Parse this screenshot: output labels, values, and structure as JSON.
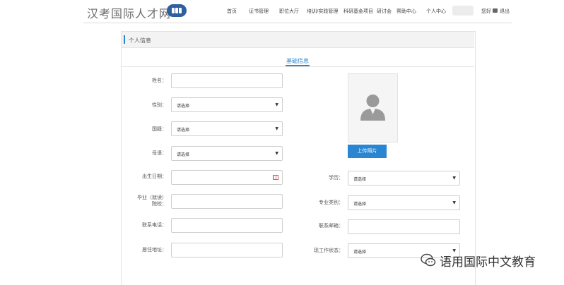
{
  "site": {
    "logo_text": "汉考国际人才网"
  },
  "nav": {
    "items": [
      "首页",
      "证书管理",
      "职位大厅",
      "培训/实践管理",
      "科研基金项目",
      "研讨会",
      "帮助中心",
      "个人中心"
    ],
    "greeting": "您好",
    "logout": "退出"
  },
  "panel": {
    "title": "个人信息"
  },
  "tabs": [
    {
      "label": "基础信息",
      "active": true
    }
  ],
  "form": {
    "select_placeholder": "请选择",
    "fields": {
      "name": {
        "label": "姓名："
      },
      "gender": {
        "label": "性别：",
        "value": "请选择"
      },
      "nationality": {
        "label": "国籍：",
        "value": "请选择"
      },
      "native_language": {
        "label": "母语：",
        "value": "请选择"
      },
      "birth_date": {
        "label": "出生日期："
      },
      "school_line1": "毕业（就读）",
      "school_line2": "院校：",
      "phone": {
        "label": "联系电话："
      },
      "address": {
        "label": "居住地址："
      },
      "education": {
        "label": "学历：",
        "value": "请选择"
      },
      "major_category": {
        "label": "专业类别：",
        "value": "请选择"
      },
      "email": {
        "label": "联系邮箱："
      },
      "work_status": {
        "label": "现工作状态：",
        "value": "请选择"
      }
    },
    "upload_label": "上传照片"
  },
  "watermark": {
    "text": "语用国际中文教育"
  },
  "colors": {
    "accent": "#2a86d1",
    "logo_badge": "#2f5f9e"
  },
  "icons": {
    "photo_placeholder": "avatar-placeholder-icon",
    "date": "calendar-icon",
    "select": "caret-down-icon"
  }
}
